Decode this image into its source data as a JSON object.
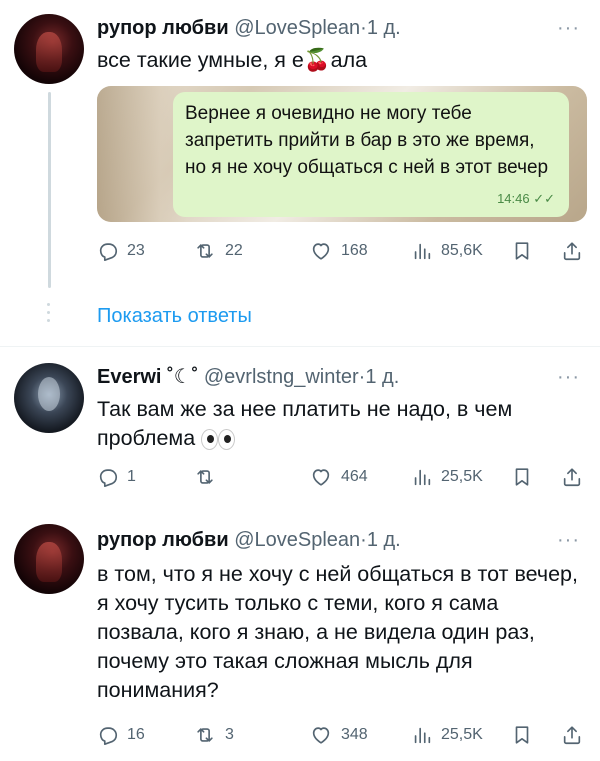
{
  "tweet1": {
    "name": "рупор любви",
    "handle": "@LoveSplean",
    "sep": "·",
    "time": "1 д.",
    "more": "···",
    "text": "все такие умные, я е🍒ала",
    "media": {
      "bubble_text": "Вернее я очевидно не могу тебе запретить прийти в бар в это же время, но я не хочу общаться с ней в этот вечер",
      "bubble_time": "14:46 ✓✓"
    },
    "actions": {
      "replies": "23",
      "retweets": "22",
      "likes": "168",
      "views": "85,6K"
    }
  },
  "show_replies": "Показать ответы",
  "tweet2": {
    "name": "Everwi ˚☾˚",
    "handle": "@evrlstng_winter",
    "sep": "·",
    "time": "1 д.",
    "more": "···",
    "text": "Так вам же за нее платить не надо, в чем проблема",
    "actions": {
      "replies": "1",
      "retweets": "",
      "likes": "464",
      "views": "25,5K"
    }
  },
  "tweet3": {
    "name": "рупор любви",
    "handle": "@LoveSplean",
    "sep": "·",
    "time": "1 д.",
    "more": "···",
    "text": "в том, что я не хочу с ней общаться в тот вечер, я хочу тусить только с теми, кого я сама позвала, кого я знаю, а не видела один раз, почему это такая сложная мысль для понимания?",
    "actions": {
      "replies": "16",
      "retweets": "3",
      "likes": "348",
      "views": "25,5K"
    }
  },
  "colors": {
    "accent": "#1d9bf0",
    "muted": "#536471",
    "bubble": "#dff5c9"
  }
}
